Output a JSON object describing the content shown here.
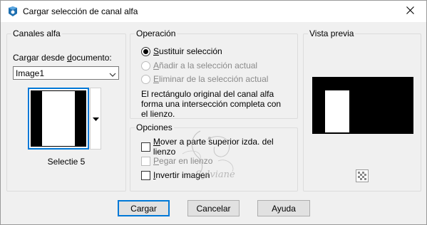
{
  "window": {
    "title": "Cargar selección de canal alfa",
    "icon": "paint-app-icon",
    "close_icon": "close-icon"
  },
  "canales": {
    "group_title": "Canales alfa",
    "load_label_pre": "Cargar desde ",
    "load_label_underlined": "d",
    "load_label_post": "ocumento:",
    "document_value": "Image1",
    "channel_name": "Selectie 5"
  },
  "operacion": {
    "group_title": "Operación",
    "options": [
      {
        "underlined": "S",
        "rest": "ustituir selección",
        "checked": true,
        "disabled": false
      },
      {
        "underlined": "A",
        "rest": "ñadir a la selección actual",
        "checked": false,
        "disabled": true
      },
      {
        "underlined": "E",
        "rest": "liminar de la selección actual",
        "checked": false,
        "disabled": true
      }
    ],
    "info_lines": [
      "El rectángulo original del canal alfa",
      "forma una intersección completa con",
      "el lienzo."
    ]
  },
  "opciones": {
    "group_title": "Opciones",
    "checks": [
      {
        "pre": "",
        "underlined": "M",
        "rest": "over a parte superior izda. del lienzo",
        "checked": false,
        "disabled": false
      },
      {
        "pre": "",
        "underlined": "P",
        "rest": "egar en lienzo",
        "checked": false,
        "disabled": true
      },
      {
        "pre": "",
        "underlined": "I",
        "rest": "nvertir imagen",
        "checked": false,
        "disabled": false
      }
    ]
  },
  "preview": {
    "group_title": "Vista previa",
    "zoom_icon": "preview-zoom-icon"
  },
  "buttons": {
    "load": "Cargar",
    "cancel": "Cancelar",
    "help": "Ayuda"
  },
  "watermark": {
    "text": "Sylviane"
  }
}
